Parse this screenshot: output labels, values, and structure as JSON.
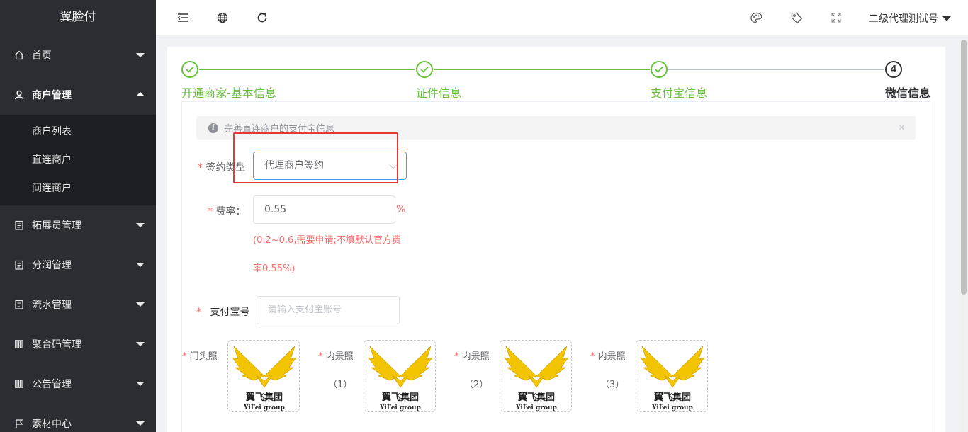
{
  "sidebar": {
    "logo": "翼脸付",
    "items": [
      {
        "label": "首页",
        "icon": "home-icon"
      },
      {
        "label": "商户管理",
        "icon": "user-icon"
      },
      {
        "label": "拓展员管理",
        "icon": "clipboard-icon"
      },
      {
        "label": "分润管理",
        "icon": "clipboard-icon"
      },
      {
        "label": "流水管理",
        "icon": "clipboard-icon"
      },
      {
        "label": "聚合码管理",
        "icon": "qrcode-icon"
      },
      {
        "label": "公告管理",
        "icon": "qrcode-icon"
      },
      {
        "label": "素材中心",
        "icon": "flag-icon"
      }
    ],
    "sub_items": [
      "商户列表",
      "直连商户",
      "间连商户"
    ]
  },
  "header": {
    "user": "二级代理测试号"
  },
  "steps": [
    {
      "title": "开通商家-基本信息",
      "status": "done"
    },
    {
      "title": "证件信息",
      "status": "done"
    },
    {
      "title": "支付宝信息",
      "status": "done"
    },
    {
      "title": "微信信息",
      "status": "current",
      "number": "4"
    }
  ],
  "alert": {
    "text": "完善直连商户的支付宝信息",
    "close": "×"
  },
  "form": {
    "sign_type": {
      "required": "*",
      "label": "签约类型",
      "value": "代理商户签约"
    },
    "rate": {
      "required": "*",
      "label": "费率：",
      "value": "0.55",
      "unit": "%",
      "hint_line1": "(0.2~0.6,需要申请;不填默认官方费",
      "hint_line2": "率0.55%)"
    },
    "alipay": {
      "required": "*",
      "label": "支付宝号",
      "placeholder": "请输入支付宝账号"
    }
  },
  "photos": [
    {
      "required": "*",
      "label": "门头照",
      "sub": ""
    },
    {
      "required": "*",
      "label": "内景照",
      "sub": "（1）"
    },
    {
      "required": "*",
      "label": "内景照",
      "sub": "（2）"
    },
    {
      "required": "*",
      "label": "内景照",
      "sub": "（3）"
    }
  ],
  "logo_image": {
    "line1": "翼飞集团",
    "line2": "YiFei group"
  },
  "colors": {
    "success": "#67c23a",
    "primary": "#409eff",
    "danger": "#f56c6c",
    "sidebar": "#2b2d33",
    "logo_gold": "#f2c500"
  }
}
